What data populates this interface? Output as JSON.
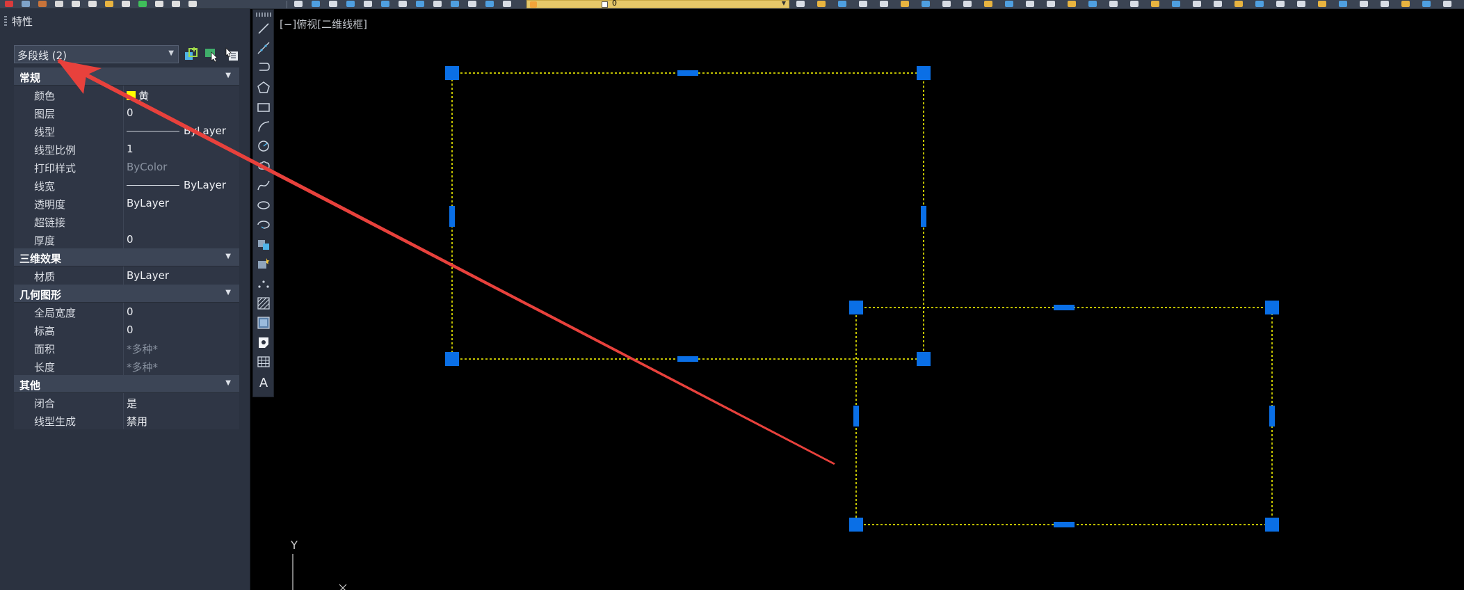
{
  "toolbar": {
    "layer_combo_value": "0"
  },
  "palette": {
    "title": "特性",
    "object_select": "多段线 (2)",
    "sections": [
      {
        "name": "常规",
        "rows": [
          {
            "key": "颜色",
            "value": "黄",
            "kind": "color"
          },
          {
            "key": "图层",
            "value": "0"
          },
          {
            "key": "线型",
            "value": "ByLayer",
            "kind": "line"
          },
          {
            "key": "线型比例",
            "value": "1"
          },
          {
            "key": "打印样式",
            "value": "ByColor",
            "kind": "dim"
          },
          {
            "key": "线宽",
            "value": "ByLayer",
            "kind": "line"
          },
          {
            "key": "透明度",
            "value": "ByLayer"
          },
          {
            "key": "超链接",
            "value": ""
          },
          {
            "key": "厚度",
            "value": "0"
          }
        ]
      },
      {
        "name": "三维效果",
        "rows": [
          {
            "key": "材质",
            "value": "ByLayer"
          }
        ]
      },
      {
        "name": "几何图形",
        "rows": [
          {
            "key": "全局宽度",
            "value": "0"
          },
          {
            "key": "标高",
            "value": "0"
          },
          {
            "key": "面积",
            "value": "*多种*",
            "kind": "dim"
          },
          {
            "key": "长度",
            "value": "*多种*",
            "kind": "dim"
          }
        ]
      },
      {
        "name": "其他",
        "rows": [
          {
            "key": "闭合",
            "value": "是"
          },
          {
            "key": "线型生成",
            "value": "禁用"
          }
        ]
      }
    ]
  },
  "drawing": {
    "viewport_label": "[−]俯视[二维线框]",
    "ucs_y_label": "Y",
    "selection_color": "#ffff00",
    "grip_color": "#0a6fe6",
    "annotation_arrow_color": "#e8413c"
  },
  "icons": {
    "palette_buttons": [
      "quick-select-icon",
      "select-objects-icon",
      "toggle-pickadd-icon"
    ],
    "draw_tools": [
      "line-icon",
      "construction-line-icon",
      "polyline-icon",
      "polygon-icon",
      "rectangle-icon",
      "arc-icon",
      "circle-icon",
      "revision-cloud-icon",
      "spline-icon",
      "ellipse-icon",
      "ellipse-arc-icon",
      "insert-block-icon",
      "make-block-icon",
      "point-icon",
      "hatch-icon",
      "gradient-icon",
      "region-icon",
      "table-icon",
      "mtext-icon"
    ]
  }
}
